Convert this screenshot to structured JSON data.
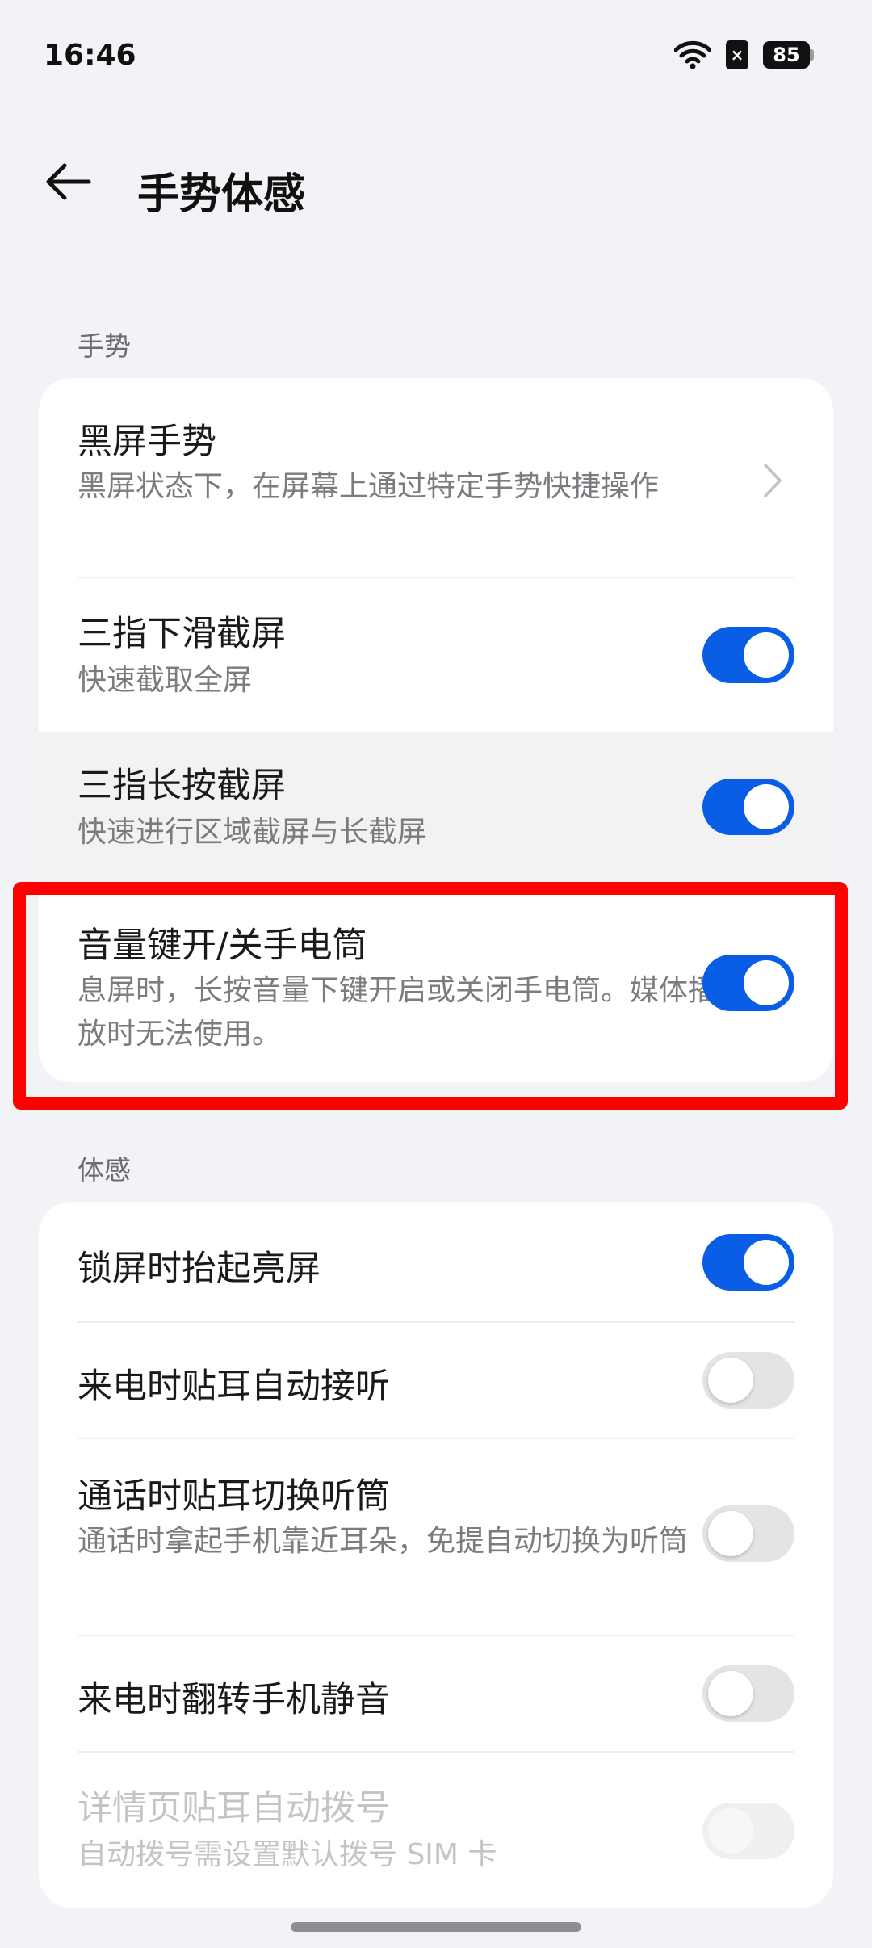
{
  "status_bar": {
    "time": "16:46",
    "sim_badge": "×",
    "battery_level": "85",
    "icons": [
      "wifi-icon",
      "sim-card-icon",
      "battery-icon"
    ]
  },
  "header": {
    "title": "手势体感",
    "back_icon": "arrow-left-icon"
  },
  "sections": {
    "gestures": {
      "label": "手势",
      "items": [
        {
          "title": "黑屏手势",
          "subtitle": "黑屏状态下，在屏幕上通过特定手势快捷操作",
          "control": "chevron"
        },
        {
          "title": "三指下滑截屏",
          "subtitle": "快速截取全屏",
          "control": "toggle",
          "on": true
        },
        {
          "title": "三指长按截屏",
          "subtitle": "快速进行区域截屏与长截屏",
          "control": "toggle",
          "on": true,
          "pressed": true
        },
        {
          "title": "音量键开/关手电筒",
          "subtitle": "息屏时，长按音量下键开启或关闭手电筒。媒体播放时无法使用。",
          "control": "toggle",
          "on": true,
          "highlighted": true
        }
      ]
    },
    "motion": {
      "label": "体感",
      "items": [
        {
          "title": "锁屏时抬起亮屏",
          "control": "toggle",
          "on": true
        },
        {
          "title": "来电时贴耳自动接听",
          "control": "toggle",
          "on": false
        },
        {
          "title": "通话时贴耳切换听筒",
          "subtitle": "通话时拿起手机靠近耳朵，免提自动切换为听筒",
          "control": "toggle",
          "on": false
        },
        {
          "title": "来电时翻转手机静音",
          "control": "toggle",
          "on": false
        },
        {
          "title": "详情页贴耳自动拨号",
          "subtitle": "自动拨号需设置默认拨号 SIM 卡",
          "control": "toggle",
          "on": false,
          "disabled": true
        }
      ]
    }
  },
  "colors": {
    "accent": "#0a5ee6",
    "background": "#f2f3f6",
    "card": "#ffffff",
    "highlight": "#ff0000"
  }
}
